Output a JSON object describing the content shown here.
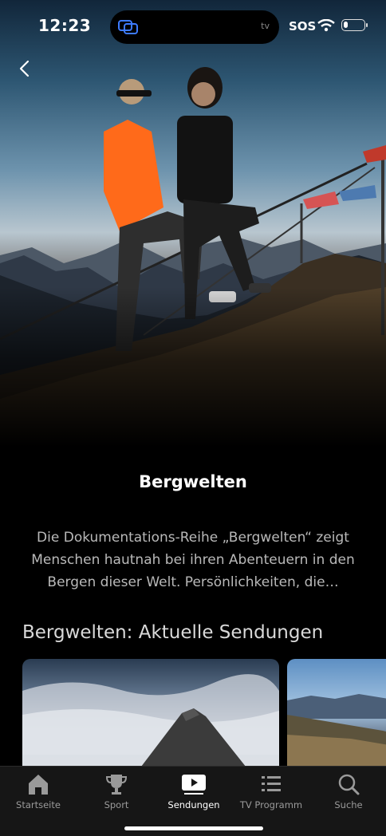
{
  "status_bar": {
    "time": "12:23",
    "island_label": "tv",
    "sos": "SOS",
    "battery_level": 0.2
  },
  "show": {
    "title": "Bergwelten",
    "description": "Die Dokumentations-Reihe „Bergwelten“ zeigt Menschen hautnah bei ihren Abenteuern in den Bergen dieser Welt. Persönlichkeiten, die…"
  },
  "section": {
    "title": "Bergwelten: Aktuelle Sendungen"
  },
  "tabs": [
    {
      "label": "Startseite",
      "icon": "home-icon",
      "active": false
    },
    {
      "label": "Sport",
      "icon": "trophy-icon",
      "active": false
    },
    {
      "label": "Sendungen",
      "icon": "play-icon",
      "active": true
    },
    {
      "label": "TV Programm",
      "icon": "list-icon",
      "active": false
    },
    {
      "label": "Suche",
      "icon": "search-icon",
      "active": false
    }
  ],
  "colors": {
    "background": "#000000",
    "tabbar": "#161616",
    "accent_orange": "#ff6a1a"
  }
}
